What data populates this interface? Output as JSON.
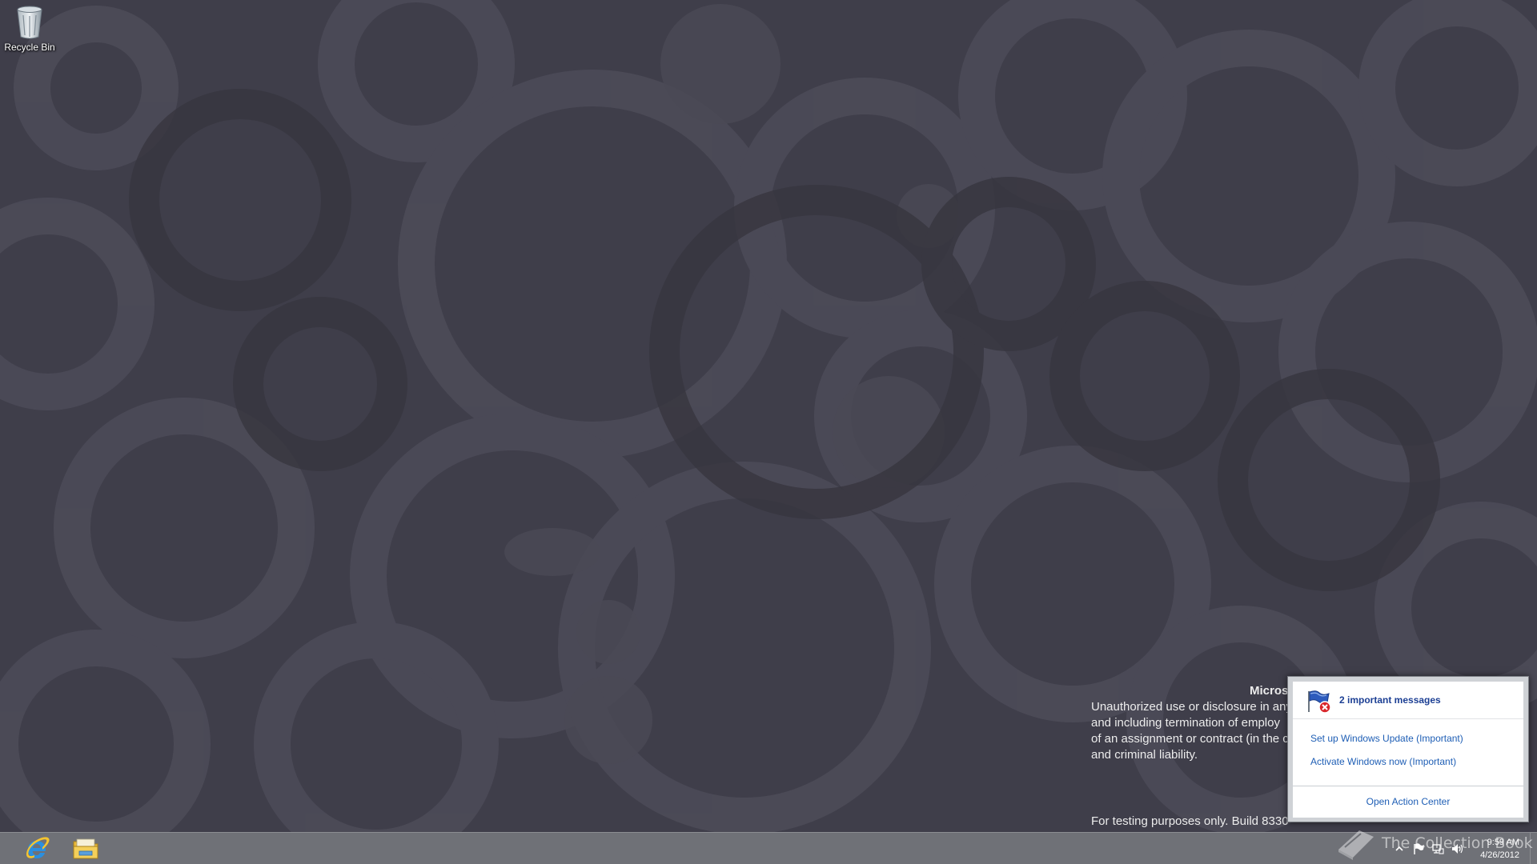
{
  "desktop": {
    "icons": [
      {
        "label": "Recycle Bin",
        "icon": "recycle-bin-icon"
      }
    ]
  },
  "watermark": {
    "title": "Micros",
    "lines": [
      "Unauthorized use or disclosure in any",
      "and including termination of employ",
      "of an assignment or contract (in the c",
      "and criminal liability."
    ],
    "build": "For testing purposes only. Build 8330"
  },
  "action_center": {
    "icon": "action-center-flag-icon",
    "title": "2 important messages",
    "messages": [
      "Set up Windows Update (Important)",
      "Activate Windows now (Important)"
    ],
    "open_label": "Open Action Center"
  },
  "taskbar": {
    "pinned": [
      {
        "name": "Internet Explorer",
        "icon": "internet-explorer-icon"
      },
      {
        "name": "File Explorer",
        "icon": "file-explorer-icon"
      }
    ],
    "tray_icons": [
      "show-hidden-icons-chevron",
      "action-center-flag-icon",
      "network-icon",
      "volume-icon"
    ],
    "clock": {
      "time": "9:59 AM",
      "date": "4/26/2012"
    }
  },
  "overlay": {
    "text": "The Collection Book"
  },
  "colors": {
    "wallpaper": "#3f3e4a",
    "taskbar": "#6f7177",
    "link": "#1e5eb5"
  }
}
